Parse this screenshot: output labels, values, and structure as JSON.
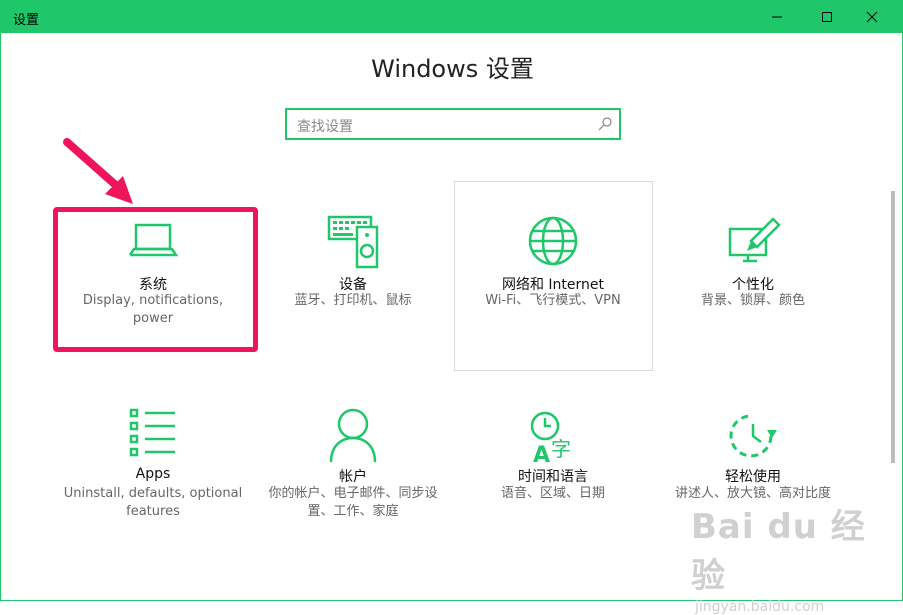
{
  "window": {
    "title": "设置",
    "controls": {
      "minimize": "—",
      "maximize": "☐",
      "close": "✕"
    }
  },
  "page_title": "Windows 设置",
  "search": {
    "placeholder": "查找设置",
    "icon": "search-icon"
  },
  "tiles": [
    {
      "name": "系统",
      "desc": "Display, notifications, power",
      "icon": "laptop-icon"
    },
    {
      "name": "设备",
      "desc": "蓝牙、打印机、鼠标",
      "icon": "devices-icon"
    },
    {
      "name": "网络和 Internet",
      "desc": "Wi-Fi、飞行模式、VPN",
      "icon": "globe-icon"
    },
    {
      "name": "个性化",
      "desc": "背景、锁屏、颜色",
      "icon": "personalization-icon"
    },
    {
      "name": "Apps",
      "desc": "Uninstall, defaults, optional features",
      "icon": "apps-list-icon"
    },
    {
      "name": "帐户",
      "desc": "你的帐户、电子邮件、同步设置、工作、家庭",
      "icon": "account-icon"
    },
    {
      "name": "时间和语言",
      "desc": "语音、区域、日期",
      "icon": "time-language-icon"
    },
    {
      "name": "轻松使用",
      "desc": "讲述人、放大镜、高对比度",
      "icon": "ease-of-access-icon"
    }
  ],
  "annotations": {
    "highlight_color": "#f0145a",
    "accent": "#1fc76a"
  },
  "watermark": {
    "main": "Bai du 经验",
    "sub": "jingyan.baidu.com"
  }
}
